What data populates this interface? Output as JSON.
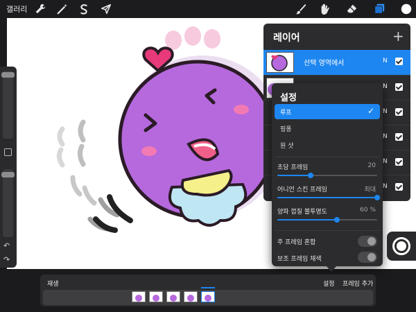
{
  "topbar": {
    "gallery_label": "갤러리",
    "left_tools": [
      "wrench-icon",
      "magic-wand-icon",
      "selection-s-icon",
      "transform-arrow-icon"
    ],
    "right_tools": [
      "brush-icon",
      "smudge-icon",
      "eraser-icon",
      "layers-icon",
      "color-disc-icon"
    ],
    "active_tool": "layers-icon"
  },
  "layers_panel": {
    "title": "레이어",
    "add_icon": "plus-icon",
    "rows": [
      {
        "name": "선택 영역에서",
        "blend": "N",
        "visible": true,
        "active": true
      },
      {
        "name": "",
        "blend": "N",
        "visible": true,
        "active": false
      },
      {
        "name": "",
        "blend": "N",
        "visible": true,
        "active": false
      },
      {
        "name": "",
        "blend": "N",
        "visible": true,
        "active": false
      },
      {
        "name": "",
        "blend": "N",
        "visible": true,
        "active": false
      },
      {
        "name": "",
        "blend": "N",
        "visible": true,
        "active": false
      }
    ]
  },
  "settings": {
    "title": "설정",
    "modes": [
      {
        "label": "루프",
        "selected": true
      },
      {
        "label": "핑퐁",
        "selected": false
      },
      {
        "label": "원 샷",
        "selected": false
      }
    ],
    "fps": {
      "label": "초당 프레임",
      "value": "20",
      "fraction": 0.33
    },
    "onion_frames": {
      "label": "어니언 스킨 프레임",
      "value": "최대",
      "fraction": 1.0
    },
    "onion_opacity": {
      "label": "양파 껍질 불투명도",
      "value": "60 %",
      "fraction": 0.6
    },
    "blend_primary": {
      "label": "주 프레임 혼합",
      "on": false
    },
    "color_secondary": {
      "label": "보조 프레임 채색",
      "on": false
    }
  },
  "timeline": {
    "play_label": "재생",
    "settings_label": "설정",
    "add_frame_label": "프레임 추가",
    "frames": 5,
    "current_frame": 5
  },
  "colors": {
    "accent": "#1d86f0",
    "panel": "#2c2c2e",
    "character": "#b569dd",
    "heart": "#e8397a"
  }
}
